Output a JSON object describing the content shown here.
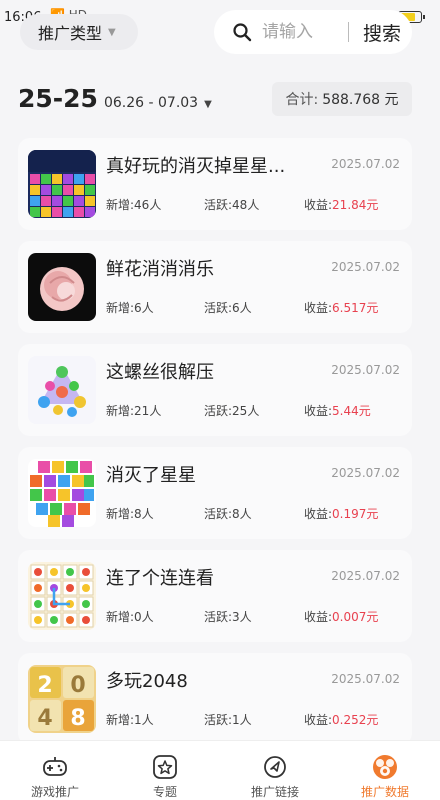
{
  "status": {
    "time": "16:06",
    "signal": "📶 HD"
  },
  "filter": {
    "type_label": "推广类型"
  },
  "search": {
    "placeholder": "请输入",
    "button": "搜索"
  },
  "week": {
    "label": "25-25",
    "range": "06.26 - 07.03"
  },
  "total": {
    "label": "合计:",
    "value": "588.768 元"
  },
  "games": [
    {
      "title": "真好玩的消灭掉星星...",
      "date": "2025.07.02",
      "new": "新增:46人",
      "active": "活跃:48人",
      "income_label": "收益:",
      "income": "21.84元"
    },
    {
      "title": "鲜花消消消乐",
      "date": "2025.07.02",
      "new": "新增:6人",
      "active": "活跃:6人",
      "income_label": "收益:",
      "income": "6.517元"
    },
    {
      "title": "这螺丝很解压",
      "date": "2025.07.02",
      "new": "新增:21人",
      "active": "活跃:25人",
      "income_label": "收益:",
      "income": "5.44元"
    },
    {
      "title": "消灭了星星",
      "date": "2025.07.02",
      "new": "新增:8人",
      "active": "活跃:8人",
      "income_label": "收益:",
      "income": "0.197元"
    },
    {
      "title": "连了个连连看",
      "date": "2025.07.02",
      "new": "新增:0人",
      "active": "活跃:3人",
      "income_label": "收益:",
      "income": "0.007元"
    },
    {
      "title": "多玩2048",
      "date": "2025.07.02",
      "new": "新增:1人",
      "active": "活跃:1人",
      "income_label": "收益:",
      "income": "0.252元"
    }
  ],
  "tabs": [
    {
      "label": "游戏推广",
      "icon": "gamepad-icon"
    },
    {
      "label": "专题",
      "icon": "star-icon"
    },
    {
      "label": "推广链接",
      "icon": "link-icon"
    },
    {
      "label": "推广数据",
      "icon": "data-icon"
    }
  ],
  "colors": {
    "accent": "#f07a2e",
    "income": "#e8414f"
  }
}
